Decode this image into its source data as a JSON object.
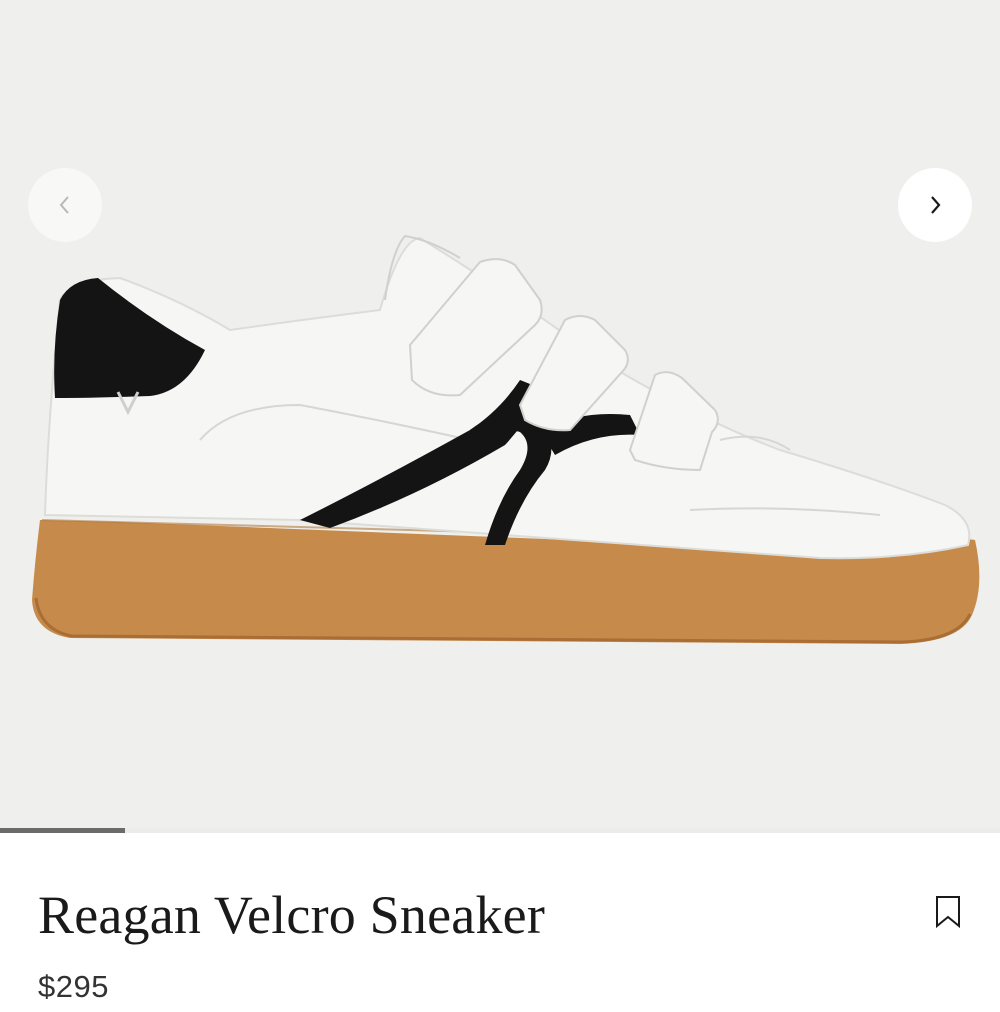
{
  "product": {
    "name": "Reagan Velcro Sneaker",
    "price": "$295"
  },
  "gallery": {
    "image_alt": "Reagan Velcro Sneaker",
    "progress_fraction": 0.125,
    "prev_icon": "chevron-left-icon",
    "next_icon": "chevron-right-icon"
  },
  "icons": {
    "bookmark": "bookmark-icon"
  },
  "colors": {
    "background": "#efefed",
    "upper": "#f6f6f4",
    "accent_black": "#141414",
    "sole": "#c68a4b",
    "text": "#1a1a1a"
  }
}
